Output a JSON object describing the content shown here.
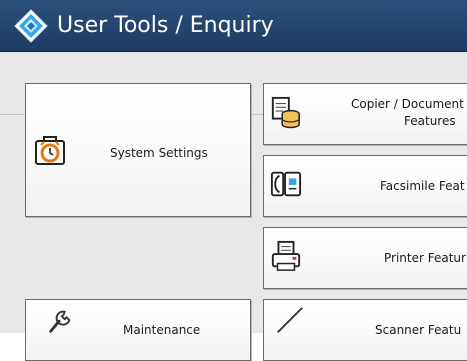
{
  "header": {
    "title": "User Tools / Enquiry",
    "icon": "user-tools-icon"
  },
  "left_tiles": {
    "system_settings": {
      "label": "System Settings",
      "icon": "alarm-clock-case-icon"
    },
    "maintenance": {
      "label": "Maintenance",
      "icon": "wrench-icon"
    }
  },
  "right_tiles": {
    "copier": {
      "label_line1": "Copier / Document",
      "label_line2": "Features",
      "icon": "copier-document-server-icon"
    },
    "facsimile": {
      "label": "Facsimile Feat",
      "icon": "facsimile-icon"
    },
    "printer": {
      "label": "Printer Featur",
      "icon": "printer-icon"
    },
    "scanner": {
      "label": "Scanner Featu",
      "icon": "scanner-icon"
    }
  },
  "colors": {
    "title_bar": "#2b4f7c",
    "background": "#e8e8e8",
    "tile_border": "#6b6b6b",
    "alarm_orange": "#e07a12"
  }
}
